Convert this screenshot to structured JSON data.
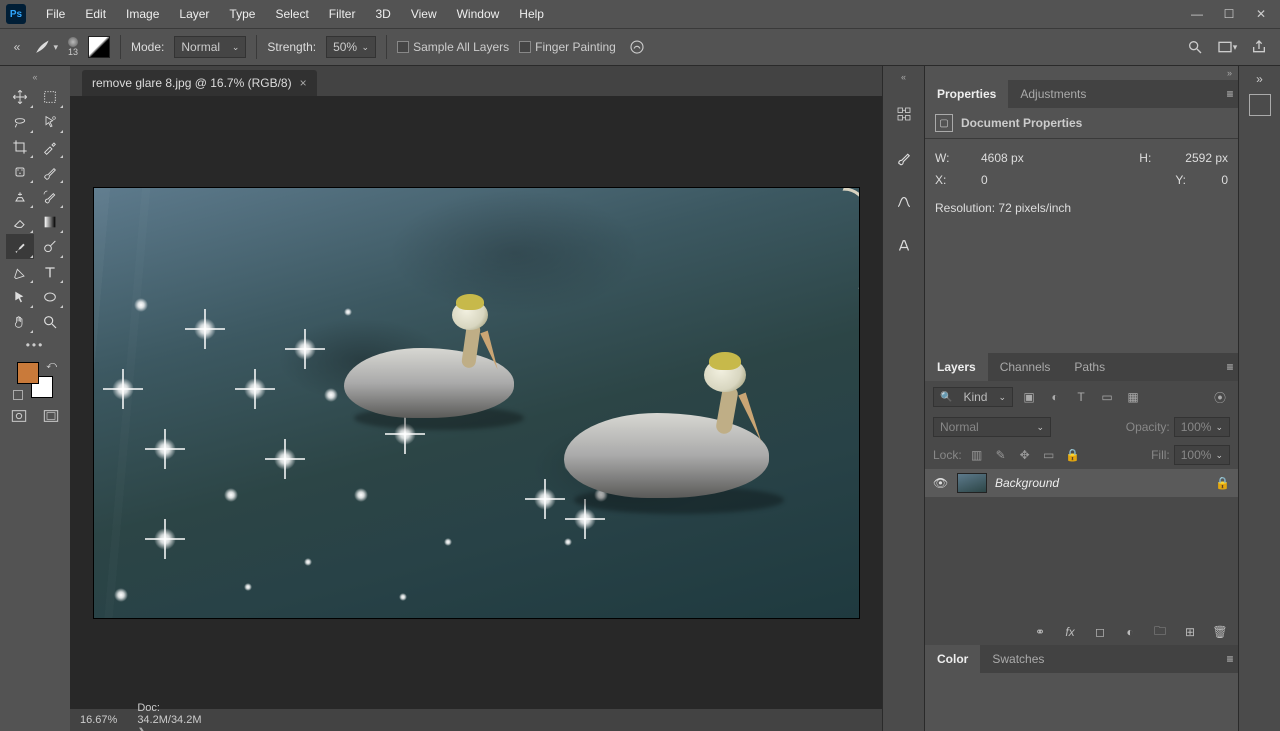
{
  "app": {
    "logo": "Ps"
  },
  "menu": {
    "items": [
      "File",
      "Edit",
      "Image",
      "Layer",
      "Type",
      "Select",
      "Filter",
      "3D",
      "View",
      "Window",
      "Help"
    ]
  },
  "options": {
    "brush_size": "13",
    "mode_label": "Mode:",
    "mode_value": "Normal",
    "strength_label": "Strength:",
    "strength_value": "50%",
    "sample_all_label": "Sample All Layers",
    "finger_paint_label": "Finger Painting"
  },
  "doc_tab": {
    "title": "remove glare 8.jpg @ 16.7% (RGB/8)"
  },
  "status": {
    "zoom": "16.67%",
    "doc_label": "Doc:",
    "doc_value": "34.2M/34.2M"
  },
  "properties": {
    "tab_properties": "Properties",
    "tab_adjustments": "Adjustments",
    "card_title": "Document Properties",
    "w_label": "W:",
    "w_value": "4608 px",
    "h_label": "H:",
    "h_value": "2592 px",
    "x_label": "X:",
    "x_value": "0",
    "y_label": "Y:",
    "y_value": "0",
    "res_label": "Resolution:",
    "res_value": "72 pixels/inch"
  },
  "layers": {
    "tabs": {
      "layers": "Layers",
      "channels": "Channels",
      "paths": "Paths"
    },
    "kind_label": "Kind",
    "blend_value": "Normal",
    "opacity_label": "Opacity:",
    "opacity_value": "100%",
    "lock_label": "Lock:",
    "fill_label": "Fill:",
    "fill_value": "100%",
    "rows": [
      {
        "name": "Background"
      }
    ]
  },
  "colorpanel": {
    "tabs": {
      "color": "Color",
      "swatches": "Swatches"
    }
  }
}
